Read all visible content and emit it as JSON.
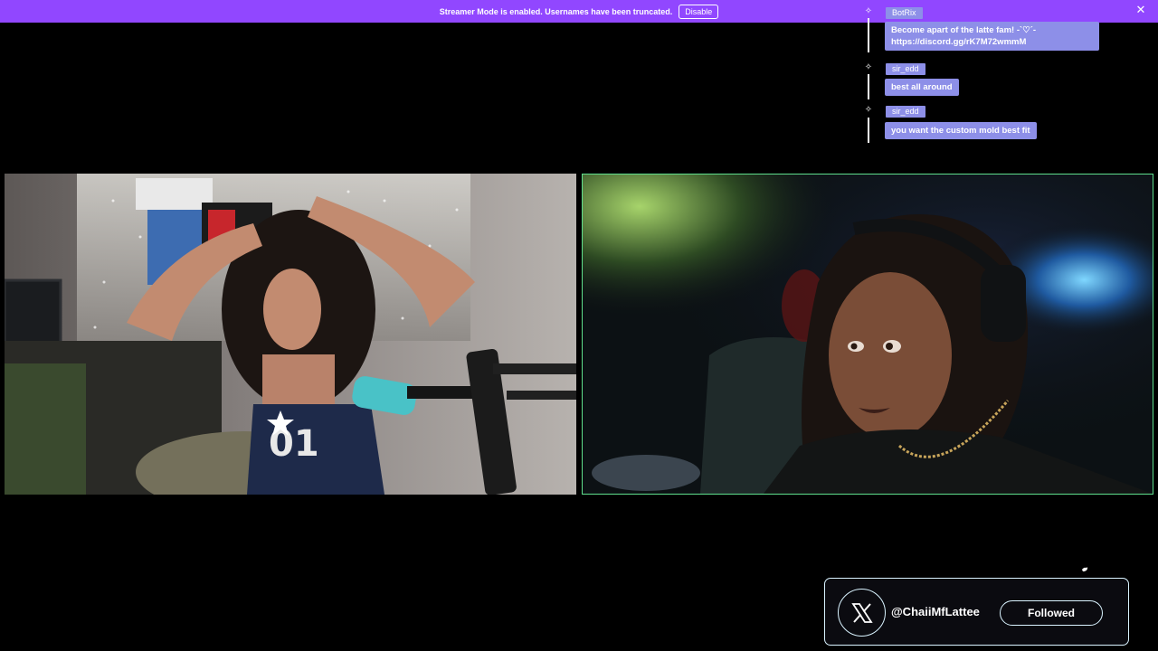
{
  "banner": {
    "text": "Streamer Mode is enabled. Usernames have been truncated.",
    "disable_label": "Disable",
    "close_icon": "close-icon",
    "bg_color": "#9147ff"
  },
  "chat": {
    "messages": [
      {
        "user": "BotRix",
        "text_line1": "Become apart of the latte fam! -`♡´-",
        "text_line2": "https://discord.gg/rK7M72wmmM"
      },
      {
        "user": "sir_edd",
        "text_line1": "best all around"
      },
      {
        "user": "sir_edd",
        "text_line1": "you want the custom mold best fit"
      }
    ],
    "bubble_color": "#8d8fe8"
  },
  "social": {
    "platform_icon": "x-logo-icon",
    "handle": "@ChaiiMfLattee",
    "follow_label": "Followed"
  },
  "accents": {
    "active_video_border": "#5fdf8d",
    "card_border": "#d9f3ff"
  }
}
